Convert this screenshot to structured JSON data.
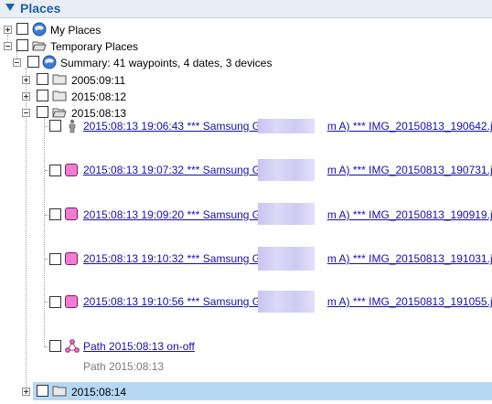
{
  "panel": {
    "title": "Places"
  },
  "tree": {
    "my_places": "My Places",
    "temporary_places": "Temporary Places",
    "summary": "Summary: 41 waypoints, 4 dates, 3 devices",
    "folders": [
      "2005:09:11",
      "2015:08:12",
      "2015:08:13",
      "2015:08:14"
    ],
    "items": [
      {
        "prefix": "2015:08:13 19:06:43 *** Samsung GT-",
        "suffix": "m A) *** IMG_20150813_190642.jpg",
        "icon": "person-icon"
      },
      {
        "prefix": "2015:08:13 19:07:32 *** Samsung GT-",
        "suffix": "m A) *** IMG_20150813_190731.jpg",
        "icon": "pink-square-icon"
      },
      {
        "prefix": "2015:08:13 19:09:20 *** Samsung GT-",
        "suffix": "m A) *** IMG_20150813_190919.jpg",
        "icon": "pink-square-icon"
      },
      {
        "prefix": "2015:08:13 19:10:32 *** Samsung GT-",
        "suffix": "m A) *** IMG_20150813_191031.jpg",
        "icon": "pink-square-icon"
      },
      {
        "prefix": "2015:08:13 19:10:56 *** Samsung GT-",
        "suffix": "m A) *** IMG_20150813_191055.jpg",
        "icon": "pink-square-icon"
      }
    ],
    "path": {
      "label": "Path 2015:08:13 on-off",
      "description": "Path 2015:08:13",
      "icon": "path-icon"
    }
  },
  "colors": {
    "accent": "#1f5fa8",
    "link": "#1a0dab",
    "selection": "#b6d8f5",
    "pink": "#f07bd0"
  }
}
